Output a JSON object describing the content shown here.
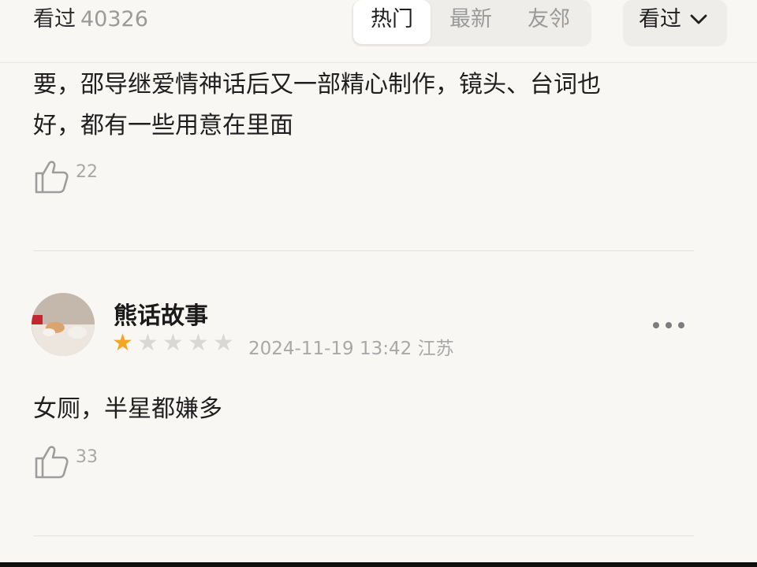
{
  "header": {
    "watched_label": "看过",
    "watched_count": "40326",
    "tabs": [
      {
        "label": "热门",
        "active": true
      },
      {
        "label": "最新",
        "active": false
      },
      {
        "label": "友邻",
        "active": false
      }
    ],
    "filter_label": "看过",
    "filter_icon": "chevron-down-icon"
  },
  "reviews": [
    {
      "text_lines": [
        "要，邵导继爱情神话后又一部精心制作，镜头、台词也",
        "好，都有一些用意在里面"
      ],
      "likes": "22",
      "like_icon": "thumbs-up-icon"
    },
    {
      "username": "熊话故事",
      "rating": 1,
      "rating_max": 5,
      "date": "2024-11-19 13:42",
      "location": "江苏",
      "text": "女厕，半星都嫌多",
      "likes": "33",
      "like_icon": "thumbs-up-icon",
      "more_icon": "more-dots-icon"
    }
  ],
  "colors": {
    "background": "#f8f7f4",
    "star_filled": "#f4a623",
    "star_empty": "#d9d8d5",
    "muted_text": "#a8a8a8"
  }
}
